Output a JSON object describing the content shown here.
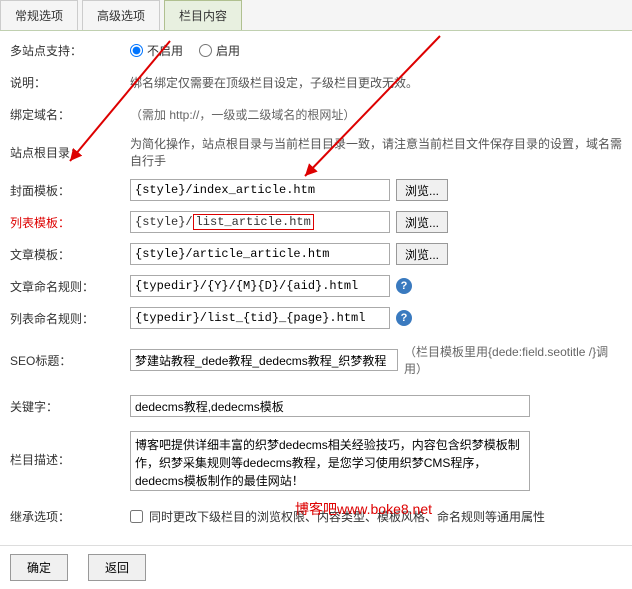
{
  "tabs": {
    "t1": "常规选项",
    "t2": "高级选项",
    "t3": "栏目内容"
  },
  "rows": {
    "multisite": {
      "label": "多站点支持：",
      "opt_off": "不启用",
      "opt_on": "启用"
    },
    "desc": {
      "label": "说明：",
      "text": "绑名绑定仅需要在顶级栏目设定，子级栏目更改无效。"
    },
    "domain": {
      "label": "绑定域名：",
      "hint": "（需加 http://，一级或二级域名的根网址）"
    },
    "root": {
      "label": "站点根目录：",
      "text": "为简化操作，站点根目录与当前栏目目录一致，请注意当前栏目文件保存目录的设置，域名需自行手"
    },
    "cover": {
      "label": "封面模板：",
      "val": "{style}/index_article.htm",
      "browse": "浏览..."
    },
    "list": {
      "label": "列表模板：",
      "prefix": "{style}/",
      "file": "list_article.htm",
      "browse": "浏览..."
    },
    "article": {
      "label": "文章模板：",
      "val": "{style}/article_article.htm",
      "browse": "浏览..."
    },
    "artrule": {
      "label": "文章命名规则：",
      "val": "{typedir}/{Y}/{M}{D}/{aid}.html"
    },
    "listrule": {
      "label": "列表命名规则：",
      "val": "{typedir}/list_{tid}_{page}.html"
    },
    "seo": {
      "label": "SEO标题：",
      "val": "梦建站教程_dede教程_dedecms教程_织梦教程",
      "hint": "（栏目模板里用{dede:field.seotitle /}调用）"
    },
    "keywords": {
      "label": "关键字：",
      "val": "dedecms教程,dedecms模板"
    },
    "descr": {
      "label": "栏目描述：",
      "val": "博客吧提供详细丰富的织梦dedecms相关经验技巧，内容包含织梦模板制作，织梦采集规则等dedecms教程，是您学习使用织梦CMS程序，dedecms模板制作的最佳网站！"
    },
    "inherit": {
      "label": "继承选项：",
      "text": "同时更改下级栏目的浏览权限、内容类型、模板风格、命名规则等通用属性"
    }
  },
  "buttons": {
    "ok": "确定",
    "back": "返回"
  },
  "watermark": "博客吧www.boke8.net"
}
